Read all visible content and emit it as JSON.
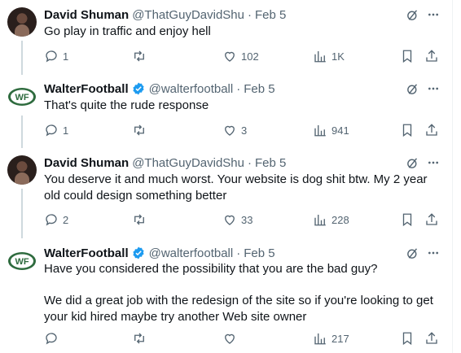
{
  "colors": {
    "text": "#0f1419",
    "muted": "#536471",
    "verified": "#1d9bf0",
    "divider": "#eff3f4",
    "wf_green": "#2e6b3e"
  },
  "tweets": [
    {
      "name": "David Shuman",
      "handle": "@ThatGuyDavidShu",
      "sep": "·",
      "date": "Feb 5",
      "verified": false,
      "lines": [
        "Go play in traffic and enjoy hell"
      ],
      "replies": "1",
      "retweets": "",
      "likes": "102",
      "views": "1K"
    },
    {
      "name": "WalterFootball",
      "handle": "@walterfootball",
      "sep": "·",
      "date": "Feb 5",
      "verified": true,
      "lines": [
        "That's quite the rude response"
      ],
      "replies": "1",
      "retweets": "",
      "likes": "3",
      "views": "941"
    },
    {
      "name": "David Shuman",
      "handle": "@ThatGuyDavidShu",
      "sep": "·",
      "date": "Feb 5",
      "verified": false,
      "lines": [
        "You deserve it and much worst. Your website is dog shit btw. My 2 year old could design something better"
      ],
      "replies": "2",
      "retweets": "",
      "likes": "33",
      "views": "228"
    },
    {
      "name": "WalterFootball",
      "handle": "@walterfootball",
      "sep": "·",
      "date": "Feb 5",
      "verified": true,
      "lines": [
        "Have you considered the possibility that you are the bad guy?",
        "We did a great job with the redesign of the site so if you're looking to get your kid hired maybe try another Web site owner"
      ],
      "replies": "",
      "retweets": "",
      "likes": "",
      "views": "217"
    }
  ],
  "wf_logo_text": "WF",
  "icons": [
    "grok-icon",
    "more-icon",
    "reply-icon",
    "retweet-icon",
    "like-icon",
    "views-icon",
    "bookmark-icon",
    "share-icon"
  ]
}
